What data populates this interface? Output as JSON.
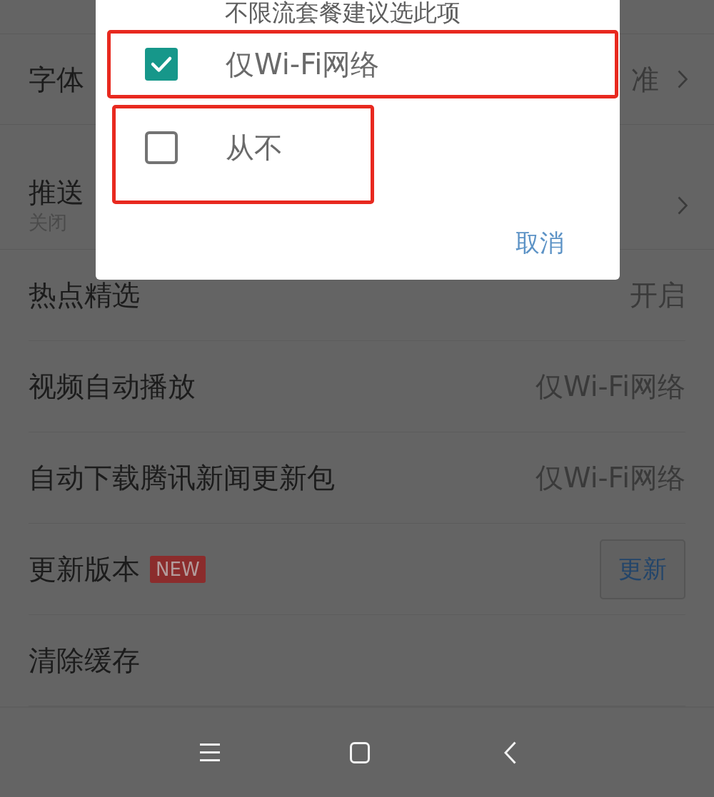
{
  "settings": {
    "sections": [
      {
        "rows": [
          {
            "kind": "link",
            "title": "字体",
            "value": "准"
          }
        ]
      },
      {
        "rows": [
          {
            "kind": "link",
            "title": "推送",
            "subtitle": "关闭"
          }
        ]
      },
      {
        "rows": [
          {
            "kind": "value",
            "title": "热点精选",
            "value": "开启"
          },
          {
            "kind": "value",
            "title": "视频自动播放",
            "value": "仅Wi-Fi网络"
          },
          {
            "kind": "value",
            "title": "自动下载腾讯新闻更新包",
            "value": "仅Wi-Fi网络"
          },
          {
            "kind": "action",
            "title": "更新版本",
            "badge": "NEW",
            "button": "更新"
          },
          {
            "kind": "plain",
            "title": "清除缓存"
          }
        ]
      }
    ]
  },
  "dialog": {
    "subtitle": "不限流套餐建议选此项",
    "options": [
      {
        "label": "仅Wi-Fi网络",
        "checked": true,
        "highlighted": true
      },
      {
        "label": "从不",
        "checked": false,
        "highlighted": true
      }
    ],
    "cancel_button": "取消"
  }
}
